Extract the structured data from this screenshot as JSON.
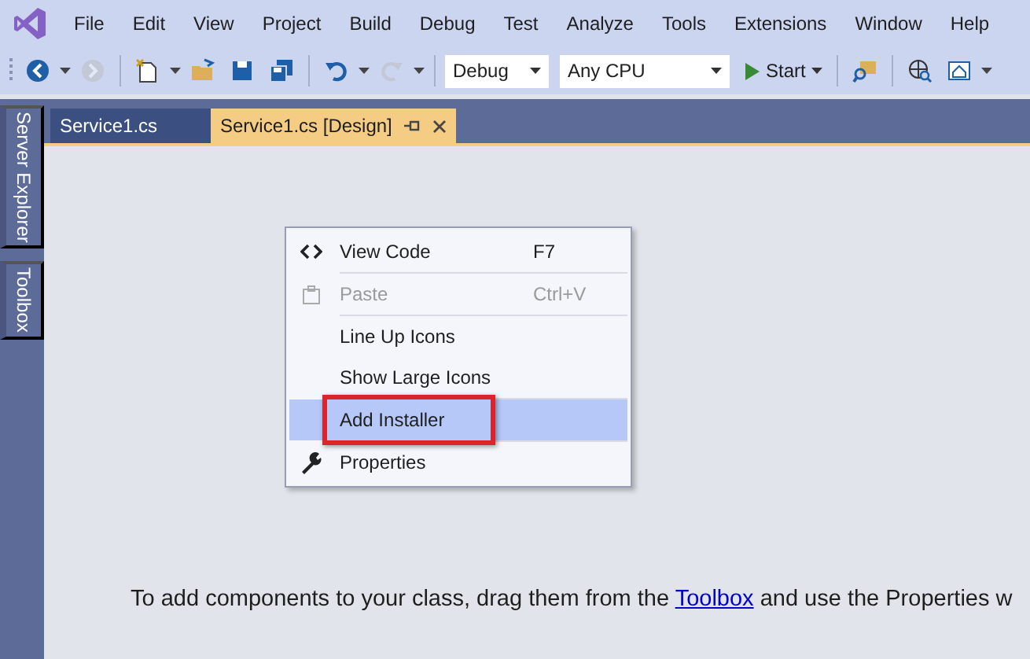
{
  "menu_bar": [
    "File",
    "Edit",
    "View",
    "Project",
    "Build",
    "Debug",
    "Test",
    "Analyze",
    "Tools",
    "Extensions",
    "Window",
    "Help"
  ],
  "toolbar": [
    {
      "kind": "icon",
      "disabled": false
    },
    {
      "kind": "caret"
    },
    {
      "kind": "icon",
      "disabled": true
    },
    {
      "kind": "sep"
    },
    {
      "kind": "icon",
      "disabled": false
    },
    {
      "kind": "caret"
    },
    {
      "kind": "icon",
      "disabled": false
    },
    {
      "kind": "icon",
      "disabled": false
    },
    {
      "kind": "icon",
      "disabled": false
    },
    {
      "kind": "sep"
    },
    {
      "kind": "icon",
      "disabled": false
    },
    {
      "kind": "caret"
    },
    {
      "kind": "icon",
      "disabled": true
    },
    {
      "kind": "caret"
    },
    {
      "kind": "sep"
    },
    {
      "kind": "combo",
      "value": "Debug"
    },
    {
      "kind": "combo",
      "value": "Any CPU"
    },
    {
      "kind": "start",
      "label": "Start"
    },
    {
      "kind": "sep"
    },
    {
      "kind": "icon",
      "disabled": false
    },
    {
      "kind": "sep"
    },
    {
      "kind": "icon",
      "disabled": false
    },
    {
      "kind": "icon",
      "disabled": false
    },
    {
      "kind": "caret"
    }
  ],
  "side_tabs": [
    "Server Explorer",
    "Toolbox"
  ],
  "tabs": [
    {
      "label": "Service1.cs",
      "selected": false
    },
    {
      "label": "Service1.cs [Design]",
      "selected": true
    }
  ],
  "context_menu": [
    {
      "label": "View Code",
      "shortcut": "F7",
      "disabled": false,
      "selected": false,
      "annotated": false,
      "separator_after": true
    },
    {
      "label": "Paste",
      "shortcut": "Ctrl+V",
      "disabled": true,
      "selected": false,
      "annotated": false,
      "separator_after": true
    },
    {
      "label": "Line Up Icons",
      "disabled": false,
      "selected": false,
      "annotated": false,
      "separator_after": false
    },
    {
      "label": "Show Large Icons",
      "disabled": false,
      "selected": false,
      "annotated": false,
      "separator_after": true
    },
    {
      "label": "Add Installer",
      "disabled": false,
      "selected": true,
      "annotated": true,
      "separator_after": true
    },
    {
      "label": "Properties",
      "disabled": false,
      "selected": false,
      "annotated": false,
      "separator_after": false
    }
  ],
  "hint": {
    "before": "To add components to your class, drag them from the ",
    "link": "Toolbox",
    "after": " and use the Properties w"
  }
}
